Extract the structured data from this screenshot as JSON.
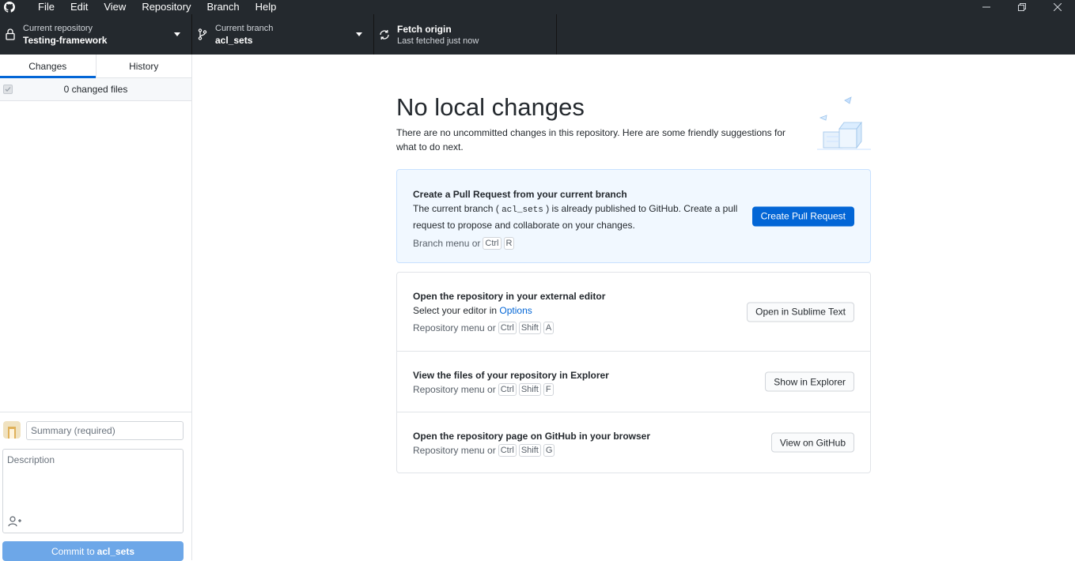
{
  "menubar": {
    "items": [
      "File",
      "Edit",
      "View",
      "Repository",
      "Branch",
      "Help"
    ]
  },
  "window_controls": [
    "minimize-icon",
    "restore-icon",
    "close-icon"
  ],
  "toolbar": {
    "repository": {
      "label": "Current repository",
      "value": "Testing-framework",
      "icon": "lock-icon"
    },
    "branch": {
      "label": "Current branch",
      "value": "acl_sets",
      "icon": "branch-icon"
    },
    "fetch": {
      "label": "Fetch origin",
      "value": "Last fetched just now",
      "icon": "sync-icon"
    }
  },
  "sidebar": {
    "tabs": [
      "Changes",
      "History"
    ],
    "selected_tab": "Changes",
    "changed_files": "0 changed files",
    "commit": {
      "summary_placeholder": "Summary (required)",
      "description_placeholder": "Description",
      "button_prefix": "Commit to",
      "button_branch": "acl_sets"
    }
  },
  "main": {
    "title": "No local changes",
    "subtitle": "There are no uncommitted changes in this repository. Here are some friendly suggestions for what to do next.",
    "pull_request": {
      "title": "Create a Pull Request from your current branch",
      "desc_before": "The current branch (",
      "desc_code": "acl_sets",
      "desc_after": ") is already published to GitHub. Create a pull request to propose and collaborate on your changes.",
      "shortcut_prefix": "Branch menu or",
      "keys": [
        "Ctrl",
        "R"
      ],
      "button": "Create Pull Request"
    },
    "actions": [
      {
        "title": "Open the repository in your external editor",
        "desc_prefix": "Select your editor in",
        "desc_link": "Options",
        "shortcut_prefix": "Repository menu or",
        "keys": [
          "Ctrl",
          "Shift",
          "A"
        ],
        "button": "Open in Sublime Text"
      },
      {
        "title": "View the files of your repository in Explorer",
        "shortcut_prefix": "Repository menu or",
        "keys": [
          "Ctrl",
          "Shift",
          "F"
        ],
        "button": "Show in Explorer"
      },
      {
        "title": "Open the repository page on GitHub in your browser",
        "shortcut_prefix": "Repository menu or",
        "keys": [
          "Ctrl",
          "Shift",
          "G"
        ],
        "button": "View on GitHub"
      }
    ]
  },
  "colors": {
    "toolbar_bg": "#24292e",
    "accent": "#0366d6",
    "commit_button_disabled": "#6da7e8",
    "primary_card_bg": "#f1f8ff"
  }
}
